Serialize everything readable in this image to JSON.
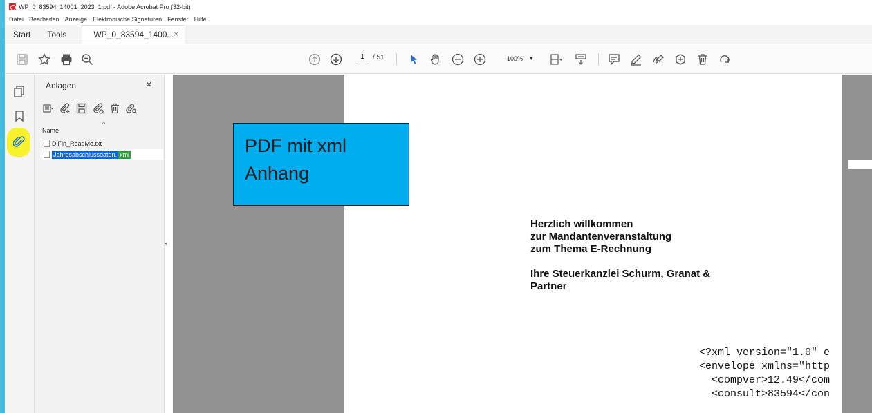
{
  "window": {
    "title": "WP_0_83594_14001_2023_1.pdf - Adobe Acrobat Pro (32-bit)"
  },
  "menu": [
    "Datei",
    "Bearbeiten",
    "Anzeige",
    "Elektronische Signaturen",
    "Fenster",
    "Hilfe"
  ],
  "tabs": {
    "start": "Start",
    "tools": "Tools",
    "document": "WP_0_83594_1400...",
    "close": "×"
  },
  "toolbar": {
    "current_page": "1",
    "page_total": "/ 51",
    "zoom": "100%",
    "zoom_caret": "▾"
  },
  "attachments_panel": {
    "title": "Anlagen",
    "close": "×",
    "column_name": "Name",
    "sort_caret": "^",
    "files": [
      {
        "name": "DiFin_ReadMe.txt"
      },
      {
        "name_base": "Jahresabschlussdaten.",
        "name_ext": "xml"
      }
    ],
    "collapse_arrow": "◂"
  },
  "callout": {
    "line1": "PDF mit xml",
    "line2": "Anhang"
  },
  "document": {
    "welcome_lines": [
      "Herzlich willkommen",
      "zur Mandantenveranstaltung",
      "zum Thema E-Rechnung"
    ],
    "firm_lines": [
      "Ihre Steuerkanzlei Schurm, Granat &",
      "Partner"
    ],
    "xml_lines": [
      "<?xml version=\"1.0\" e",
      "<envelope xmlns=\"http",
      "  <compver>12.49</com",
      "  <consult>83594</con"
    ]
  }
}
